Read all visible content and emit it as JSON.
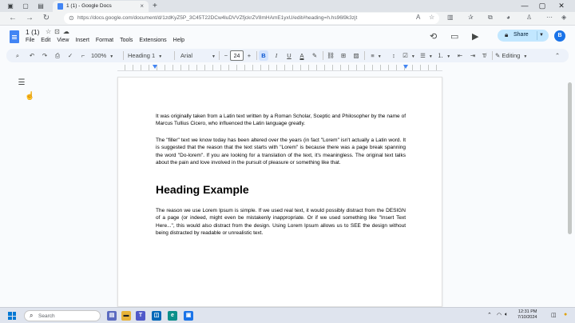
{
  "browser": {
    "tab_title": "1 (1) - Google Docs",
    "url": "https://docs.google.com/document/d/1zdKyZ5P_3C45T22DCw4luDVVZfjckrZV8mHAmE1yxU/edit#heading=h.hs96l9k3zjt"
  },
  "docs": {
    "title": "1 (1)",
    "menu": [
      "File",
      "Edit",
      "View",
      "Insert",
      "Format",
      "Tools",
      "Extensions",
      "Help"
    ],
    "share_label": "Share",
    "avatar_initial": "B"
  },
  "toolbar": {
    "zoom": "100%",
    "style": "Heading 1",
    "font": "Arial",
    "font_size": "24",
    "mode": "Editing",
    "bold_active": true
  },
  "document": {
    "paragraphs": [
      "It was originally taken from a Latin text written by a Roman Scholar, Sceptic and Philosopher by the name of Marcus Tullius Cicero, who influenced the Latin language greatly.",
      "The \"filler\" text we know today has been altered over the years (in fact \"Lorem\" isn't actually a Latin word. It is suggested that the reason that the text starts with \"Lorem\" is because there was a page break spanning the word \"Do-lorem\". If you are looking for a translation of the text, it's meaningless. The original text talks about the pain and love involved in the pursuit of pleasure or something like that.",
      "The reason we use Lorem Ipsum is simple. If we used real text, it would possibly distract from the DESIGN of a page (or indeed, might even be mistakenly inappropriate. Or if we used something like \"Insert Text Here...\", this would also distract from the design. Using Lorem Ipsum allows us to SEE the design without being distracted by readable or unrealistic text."
    ],
    "heading": "Heading Example"
  },
  "taskbar": {
    "search_placeholder": "Search",
    "time": "12:31 PM",
    "date": "7/10/2024"
  },
  "colors": {
    "accent": "#1a73e8",
    "share_bg": "#c2e7ff",
    "toolbar_bg": "#edf2fa"
  }
}
